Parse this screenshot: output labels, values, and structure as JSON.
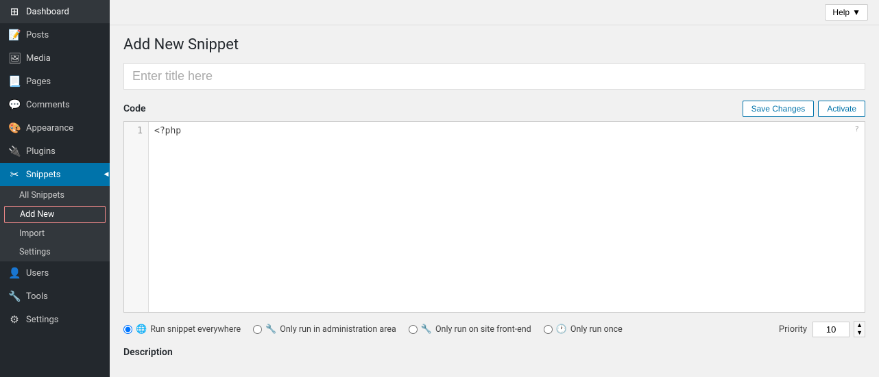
{
  "sidebar": {
    "items": [
      {
        "id": "dashboard",
        "label": "Dashboard",
        "icon": "⊞"
      },
      {
        "id": "posts",
        "label": "Posts",
        "icon": "📄"
      },
      {
        "id": "media",
        "label": "Media",
        "icon": "🖼"
      },
      {
        "id": "pages",
        "label": "Pages",
        "icon": "📃"
      },
      {
        "id": "comments",
        "label": "Comments",
        "icon": "💬"
      },
      {
        "id": "appearance",
        "label": "Appearance",
        "icon": "🎨"
      },
      {
        "id": "plugins",
        "label": "Plugins",
        "icon": "🔌"
      },
      {
        "id": "snippets",
        "label": "Snippets",
        "icon": "✂"
      },
      {
        "id": "users",
        "label": "Users",
        "icon": "👤"
      },
      {
        "id": "tools",
        "label": "Tools",
        "icon": "🔧"
      },
      {
        "id": "settings",
        "label": "Settings",
        "icon": "⚙"
      }
    ],
    "snippets_submenu": [
      {
        "id": "all-snippets",
        "label": "All Snippets"
      },
      {
        "id": "add-new",
        "label": "Add New",
        "active": true
      },
      {
        "id": "import",
        "label": "Import"
      },
      {
        "id": "settings",
        "label": "Settings"
      }
    ]
  },
  "topbar": {
    "help_label": "Help",
    "help_arrow": "▼"
  },
  "main": {
    "page_title": "Add New Snippet",
    "title_input_placeholder": "Enter title here",
    "code_label": "Code",
    "save_changes_label": "Save Changes",
    "activate_label": "Activate",
    "code_content": "<?php",
    "line_numbers": [
      "1"
    ],
    "code_help_icon": "?",
    "run_options": [
      {
        "id": "everywhere",
        "label": "Run snippet everywhere",
        "checked": true,
        "icon": "🌐"
      },
      {
        "id": "admin",
        "label": "Only run in administration area",
        "checked": false,
        "icon": "🔧"
      },
      {
        "id": "frontend",
        "label": "Only run on site front-end",
        "checked": false,
        "icon": "🔧"
      },
      {
        "id": "once",
        "label": "Only run once",
        "checked": false,
        "icon": "🕐"
      }
    ],
    "priority_label": "Priority",
    "priority_value": "10",
    "description_label": "Description"
  }
}
